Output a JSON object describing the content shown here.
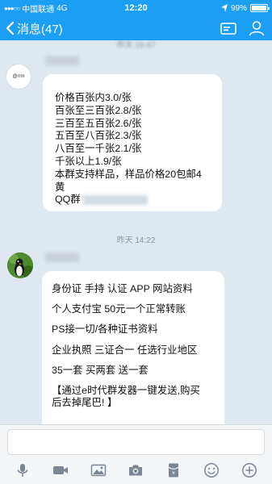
{
  "status_bar": {
    "carrier": "中国联通",
    "network": "4G",
    "time": "12:20",
    "battery_text": "99%",
    "battery_level": 0.99
  },
  "nav": {
    "back_label": "消息(47)",
    "accent_color": "#1d9ef5"
  },
  "chat": {
    "timestamp_1": "昨天 16:47",
    "timestamp_2": "昨天 14:22",
    "avatar_1_text": "@rrm",
    "message_1": {
      "lines": [
        "价格百张内3.0/张",
        "百张至三百张2.8/张",
        "三百至五百张2.6/张",
        "五百至八百张2.3/张",
        "八百至一千张2.1/张",
        "千张以上1.9/张",
        "本群支持样品，样品价格20包邮4",
        "黄"
      ],
      "qq_prefix": "QQ群"
    },
    "message_2": {
      "lines": [
        "身份证 手持  认证 APP 网站资料",
        "个人支付宝 50元一个正常转账",
        "PS接一切/各种证书资料",
        "企业执照 三证合一  任选行业地区",
        "35一套  买两套 送一套",
        "【通过e时代群发器一键发送,购买",
        "后去掉尾巴! 】"
      ]
    }
  },
  "toolbar": {
    "icons": [
      "mic-icon",
      "video-icon",
      "image-icon",
      "camera-icon",
      "red-packet-icon",
      "emoji-icon",
      "plus-icon"
    ]
  }
}
